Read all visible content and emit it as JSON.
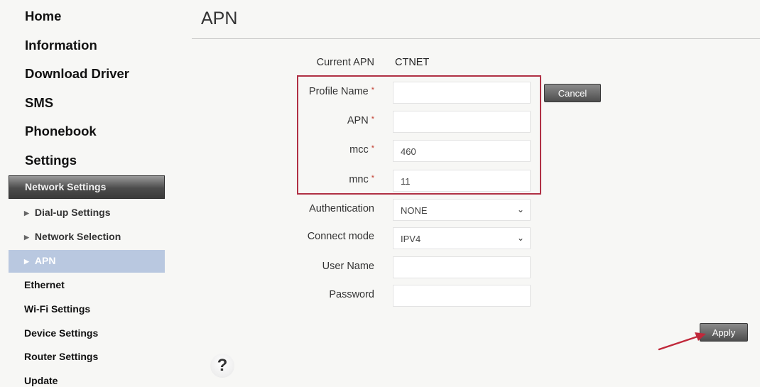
{
  "sidebar": {
    "top_items": [
      {
        "label": "Home"
      },
      {
        "label": "Information"
      },
      {
        "label": "Download Driver"
      },
      {
        "label": "SMS"
      },
      {
        "label": "Phonebook"
      },
      {
        "label": "Settings"
      }
    ],
    "section_label": "Network Settings",
    "sub_items": [
      {
        "label": "Dial-up Settings"
      },
      {
        "label": "Network Selection"
      },
      {
        "label": "APN"
      }
    ],
    "lower_items": [
      {
        "label": "Ethernet"
      },
      {
        "label": "Wi-Fi Settings"
      },
      {
        "label": "Device Settings"
      },
      {
        "label": "Router Settings"
      },
      {
        "label": "Update"
      }
    ]
  },
  "main": {
    "title": "APN",
    "current_apn_label": "Current APN",
    "current_apn_value": "CTNET",
    "required_mark": "*",
    "profile_name": {
      "label": "Profile Name",
      "value": ""
    },
    "apn": {
      "label": "APN",
      "value": ""
    },
    "mcc": {
      "label": "mcc",
      "value": "460"
    },
    "mnc": {
      "label": "mnc",
      "value": "11"
    },
    "authentication": {
      "label": "Authentication",
      "value": "NONE"
    },
    "connect_mode": {
      "label": "Connect mode",
      "value": "IPV4"
    },
    "user_name": {
      "label": "User Name",
      "value": ""
    },
    "password": {
      "label": "Password",
      "value": ""
    },
    "cancel_label": "Cancel",
    "apply_label": "Apply",
    "help_glyph": "?"
  },
  "icons": {
    "caret": "caret-right-icon",
    "chevron": "chevron-down-icon",
    "help": "help-icon",
    "arrow": "red-arrow"
  },
  "colors": {
    "highlight_box": "#b03044",
    "active_nav": "#b9c8e0",
    "button": "#5a5a5a",
    "arrow": "#c0283a"
  }
}
